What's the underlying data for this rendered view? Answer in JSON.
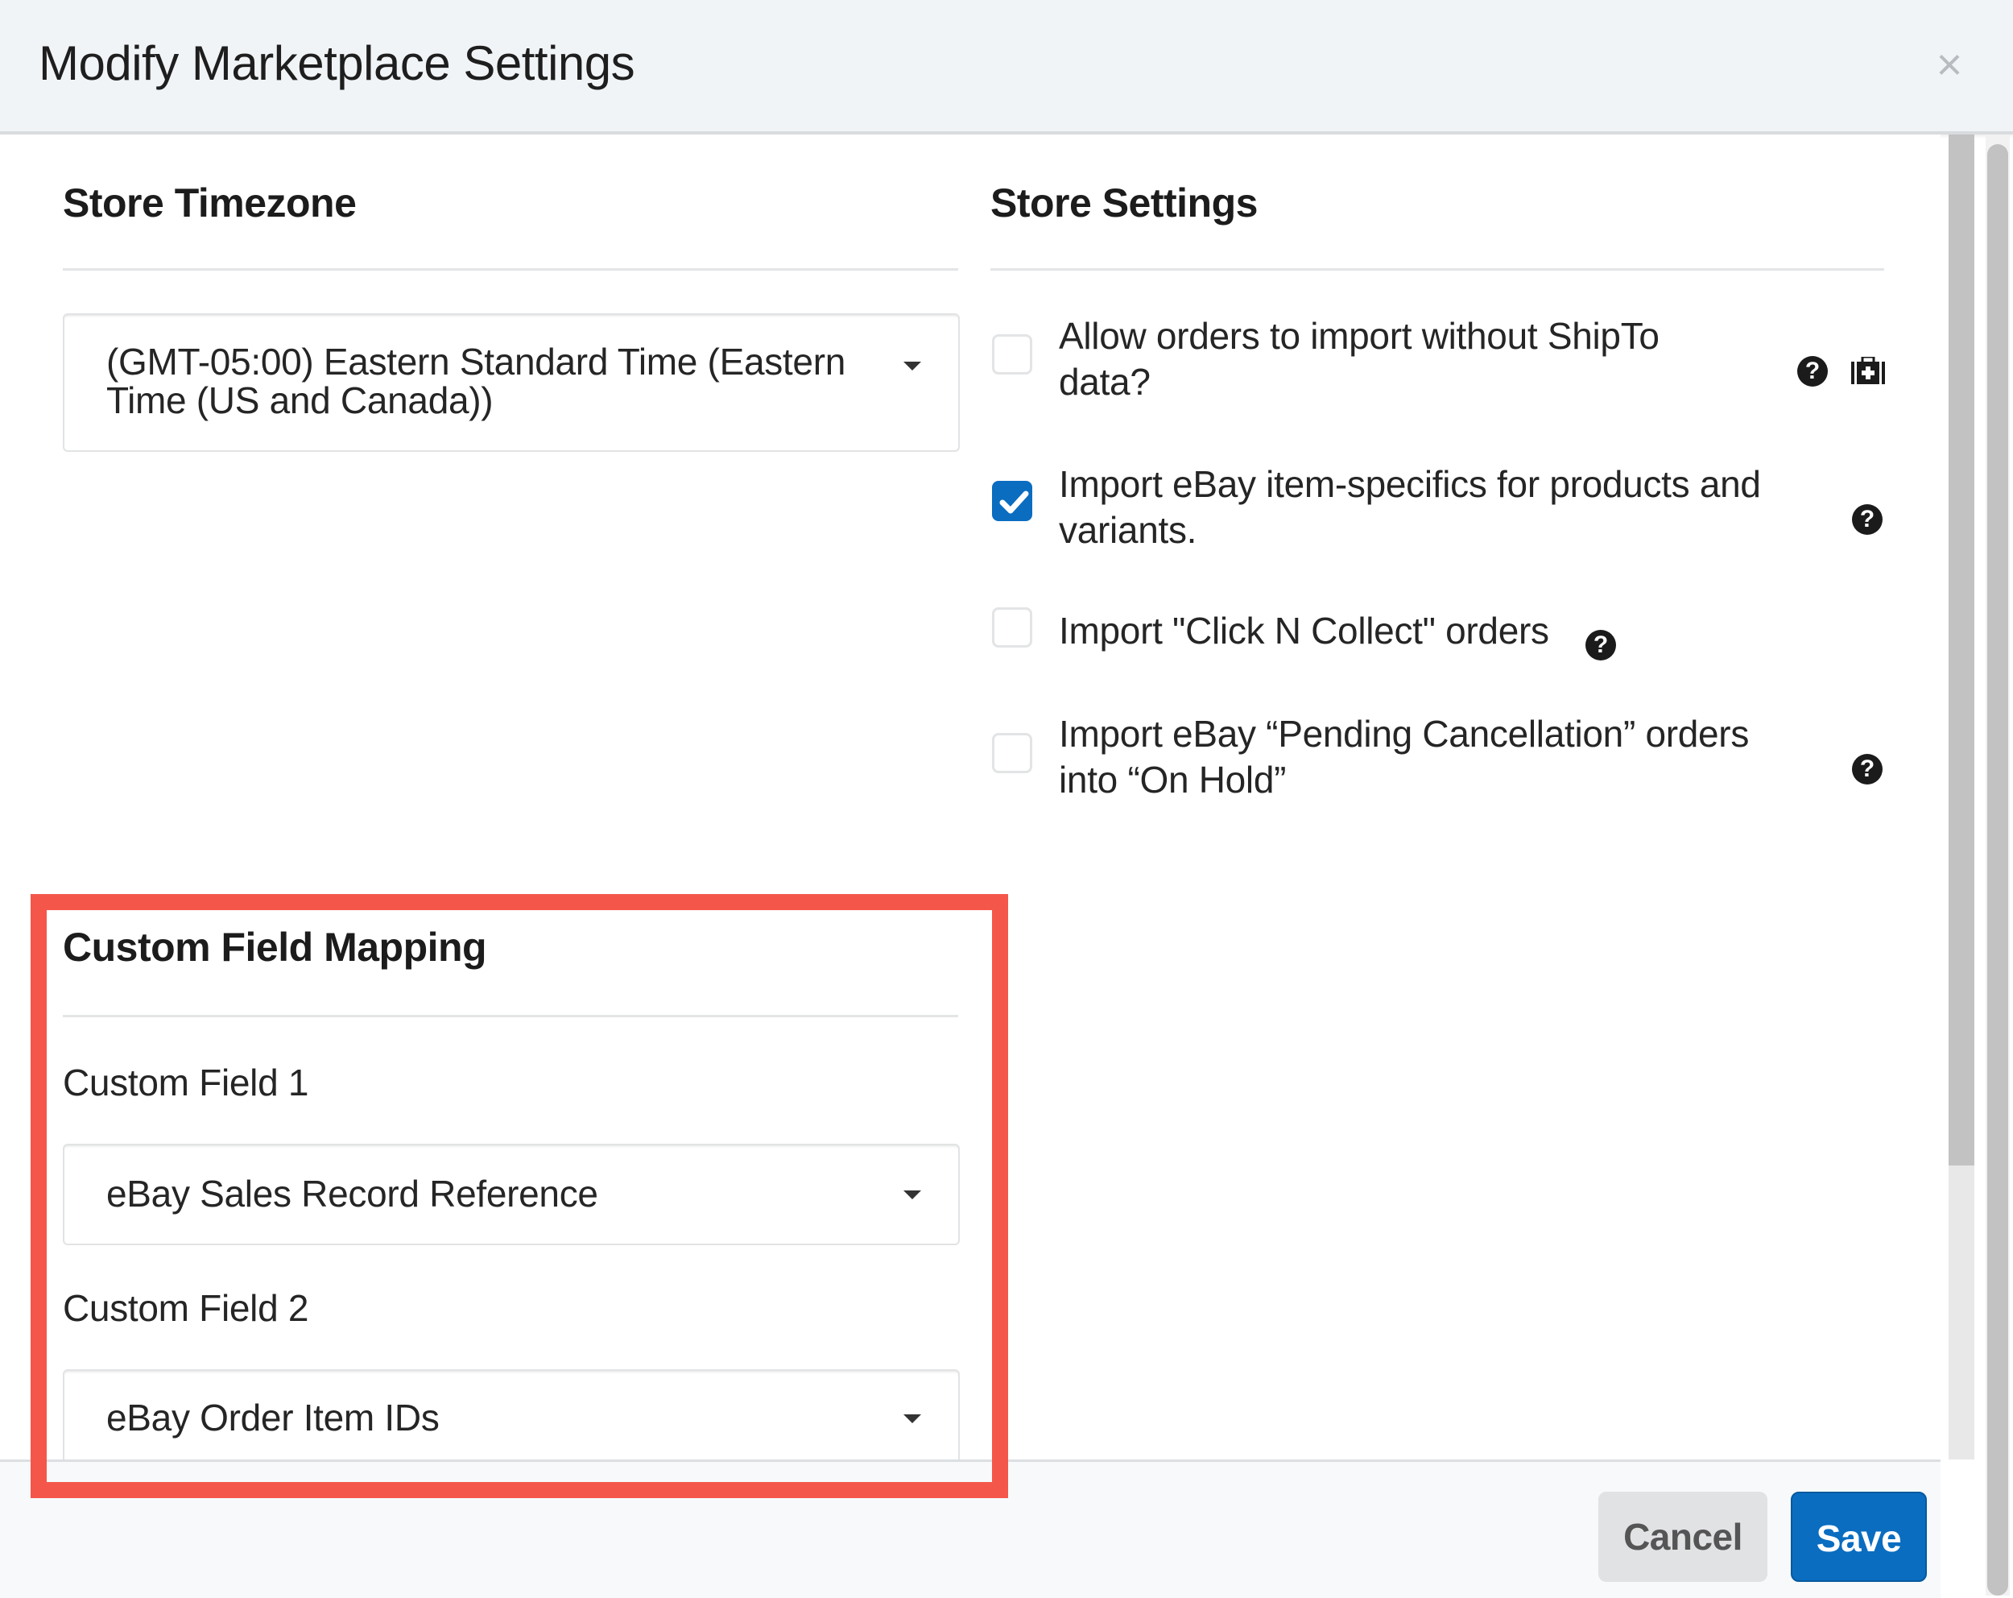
{
  "modal": {
    "title": "Modify Marketplace Settings",
    "close_icon": "close-icon"
  },
  "timezone": {
    "heading": "Store Timezone",
    "selected_line1": "(GMT-05:00) Eastern Standard Time (Eastern",
    "selected_line2": "Time (US and Canada))"
  },
  "store_settings": {
    "heading": "Store Settings",
    "options": [
      {
        "line1": "Allow orders to import without ShipTo",
        "line2": "data?",
        "checked": false,
        "icons": [
          "help-icon",
          "medkit-icon"
        ]
      },
      {
        "line1": "Import eBay item-specifics for products and",
        "line2": "variants.",
        "checked": true,
        "icons": [
          "help-icon"
        ]
      },
      {
        "line1": "Import \"Click N Collect\" orders",
        "line2": "",
        "checked": false,
        "icons": [
          "help-icon"
        ]
      },
      {
        "line1": "Import eBay “Pending Cancellation” orders",
        "line2": "into “On Hold”",
        "checked": false,
        "icons": [
          "help-icon"
        ]
      }
    ]
  },
  "custom_field_mapping": {
    "heading": "Custom Field Mapping",
    "fields": [
      {
        "label": "Custom Field 1",
        "selected": "eBay Sales Record Reference"
      },
      {
        "label": "Custom Field 2",
        "selected": "eBay Order Item IDs"
      }
    ]
  },
  "footer": {
    "cancel_label": "Cancel",
    "save_label": "Save"
  },
  "icons": {
    "help_glyph": "?",
    "close_glyph": "×"
  },
  "colors": {
    "primary": "#0a6dc0",
    "highlight": "#f4574a",
    "header_bg": "#f1f4f7"
  }
}
